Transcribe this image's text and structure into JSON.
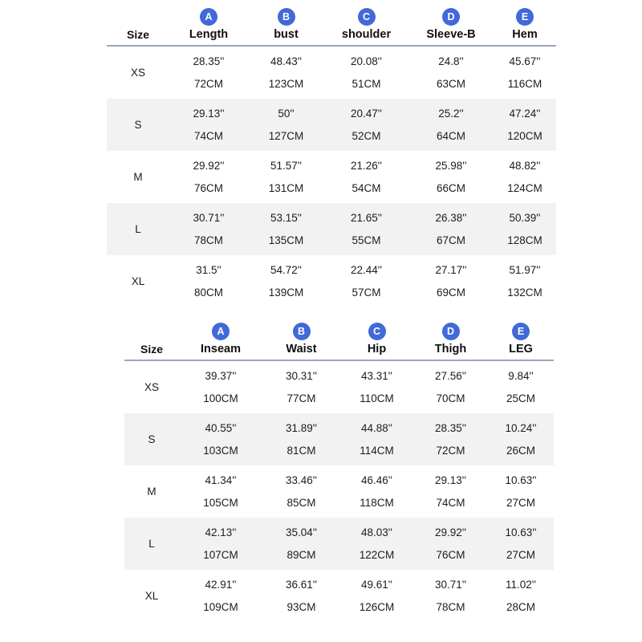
{
  "tables": [
    {
      "id": "top-size-chart",
      "size_header": "Size",
      "columns": [
        {
          "badge": "A",
          "label": "Length"
        },
        {
          "badge": "B",
          "label": "bust"
        },
        {
          "badge": "C",
          "label": "shoulder"
        },
        {
          "badge": "D",
          "label": "Sleeve-B"
        },
        {
          "badge": "E",
          "label": "Hem"
        }
      ],
      "rows": [
        {
          "size": "XS",
          "inches": [
            "28.35''",
            "48.43''",
            "20.08''",
            "24.8''",
            "45.67''"
          ],
          "cm": [
            "72CM",
            "123CM",
            "51CM",
            "63CM",
            "116CM"
          ]
        },
        {
          "size": "S",
          "inches": [
            "29.13''",
            "50''",
            "20.47''",
            "25.2''",
            "47.24''"
          ],
          "cm": [
            "74CM",
            "127CM",
            "52CM",
            "64CM",
            "120CM"
          ]
        },
        {
          "size": "M",
          "inches": [
            "29.92''",
            "51.57''",
            "21.26''",
            "25.98''",
            "48.82''"
          ],
          "cm": [
            "76CM",
            "131CM",
            "54CM",
            "66CM",
            "124CM"
          ]
        },
        {
          "size": "L",
          "inches": [
            "30.71''",
            "53.15''",
            "21.65''",
            "26.38''",
            "50.39''"
          ],
          "cm": [
            "78CM",
            "135CM",
            "55CM",
            "67CM",
            "128CM"
          ]
        },
        {
          "size": "XL",
          "inches": [
            "31.5''",
            "54.72''",
            "22.44''",
            "27.17''",
            "51.97''"
          ],
          "cm": [
            "80CM",
            "139CM",
            "57CM",
            "69CM",
            "132CM"
          ]
        }
      ]
    },
    {
      "id": "bottom-size-chart",
      "size_header": "Size",
      "columns": [
        {
          "badge": "A",
          "label": "Inseam"
        },
        {
          "badge": "B",
          "label": "Waist"
        },
        {
          "badge": "C",
          "label": "Hip"
        },
        {
          "badge": "D",
          "label": "Thigh"
        },
        {
          "badge": "E",
          "label": "LEG"
        }
      ],
      "rows": [
        {
          "size": "XS",
          "inches": [
            "39.37''",
            "30.31''",
            "43.31''",
            "27.56''",
            "9.84''"
          ],
          "cm": [
            "100CM",
            "77CM",
            "110CM",
            "70CM",
            "25CM"
          ]
        },
        {
          "size": "S",
          "inches": [
            "40.55''",
            "31.89''",
            "44.88''",
            "28.35''",
            "10.24''"
          ],
          "cm": [
            "103CM",
            "81CM",
            "114CM",
            "72CM",
            "26CM"
          ]
        },
        {
          "size": "M",
          "inches": [
            "41.34''",
            "33.46''",
            "46.46''",
            "29.13''",
            "10.63''"
          ],
          "cm": [
            "105CM",
            "85CM",
            "118CM",
            "74CM",
            "27CM"
          ]
        },
        {
          "size": "L",
          "inches": [
            "42.13''",
            "35.04''",
            "48.03''",
            "29.92''",
            "10.63''"
          ],
          "cm": [
            "107CM",
            "89CM",
            "122CM",
            "76CM",
            "27CM"
          ]
        },
        {
          "size": "XL",
          "inches": [
            "42.91''",
            "36.61''",
            "49.61''",
            "30.71''",
            "11.02''"
          ],
          "cm": [
            "109CM",
            "93CM",
            "126CM",
            "78CM",
            "28CM"
          ]
        }
      ]
    }
  ],
  "colors": {
    "badge_blue": "#4169d9",
    "header_rule": "#9aa6bb",
    "stripe": "#f2f2f2",
    "text": "#1c1c1c",
    "background": "#ffffff"
  }
}
